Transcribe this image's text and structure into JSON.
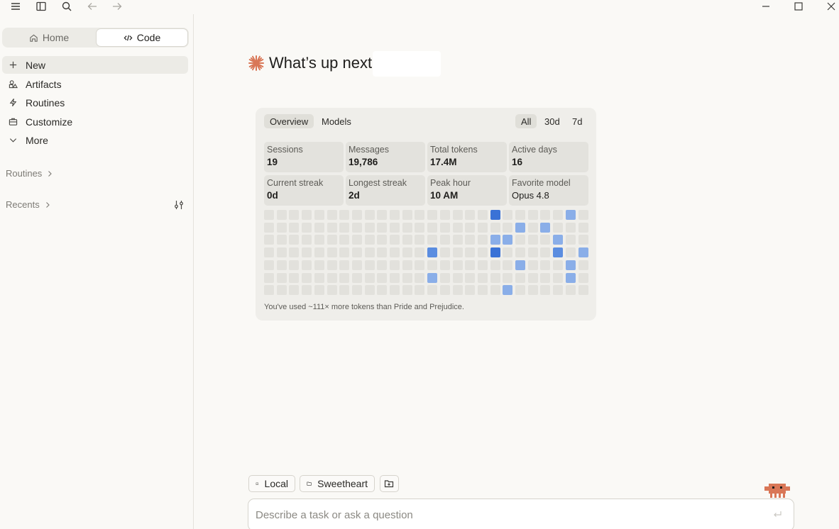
{
  "topbar": {
    "icons": [
      "menu-icon",
      "sidebar-toggle-icon",
      "search-icon",
      "back-arrow-icon",
      "forward-arrow-icon",
      "minimize-icon",
      "maximize-icon",
      "close-icon"
    ]
  },
  "sidebar": {
    "segments": [
      {
        "label": "Home",
        "icon": "home-icon",
        "active": false
      },
      {
        "label": "Code",
        "icon": "code-icon",
        "active": true
      }
    ],
    "nav": [
      {
        "label": "New",
        "icon": "plus-icon"
      },
      {
        "label": "Artifacts",
        "icon": "artifacts-icon"
      },
      {
        "label": "Routines",
        "icon": "bolt-icon"
      },
      {
        "label": "Customize",
        "icon": "briefcase-icon"
      },
      {
        "label": "More",
        "icon": "chevron-down-icon"
      }
    ],
    "sections": [
      {
        "label": "Routines"
      },
      {
        "label": "Recents"
      }
    ]
  },
  "main": {
    "greeting": "What’s up next,"
  },
  "stats": {
    "tabs": [
      "Overview",
      "Models"
    ],
    "ranges": [
      "All",
      "30d",
      "7d"
    ],
    "cards": [
      {
        "label": "Sessions",
        "value": "19"
      },
      {
        "label": "Messages",
        "value": "19,786"
      },
      {
        "label": "Total tokens",
        "value": "17.4M"
      },
      {
        "label": "Active days",
        "value": "16"
      },
      {
        "label": "Current streak",
        "value": "0d"
      },
      {
        "label": "Longest streak",
        "value": "2d"
      },
      {
        "label": "Peak hour",
        "value": "10 AM"
      },
      {
        "label": "Favorite model",
        "value": "Opus 4.8"
      }
    ],
    "heatmap": {
      "columns": 26,
      "rows": 7,
      "active_cells": [
        {
          "col": 18,
          "row": 0,
          "level": 3
        },
        {
          "col": 24,
          "row": 0,
          "level": 1
        },
        {
          "col": 20,
          "row": 1,
          "level": 1
        },
        {
          "col": 22,
          "row": 1,
          "level": 1
        },
        {
          "col": 18,
          "row": 2,
          "level": 1
        },
        {
          "col": 19,
          "row": 2,
          "level": 1
        },
        {
          "col": 23,
          "row": 2,
          "level": 1
        },
        {
          "col": 13,
          "row": 3,
          "level": 2
        },
        {
          "col": 18,
          "row": 3,
          "level": 3
        },
        {
          "col": 23,
          "row": 3,
          "level": 2
        },
        {
          "col": 25,
          "row": 3,
          "level": 1
        },
        {
          "col": 20,
          "row": 4,
          "level": 1
        },
        {
          "col": 24,
          "row": 4,
          "level": 1
        },
        {
          "col": 13,
          "row": 5,
          "level": 1
        },
        {
          "col": 24,
          "row": 5,
          "level": 1
        },
        {
          "col": 19,
          "row": 6,
          "level": 1
        }
      ]
    },
    "footer": "You've used ~111× more tokens than Pride and Prejudice."
  },
  "composer": {
    "env_label": "Local",
    "folder_label": "Sweetheart",
    "placeholder": "Describe a task or ask a question"
  },
  "colors": {
    "accent": "#d97757",
    "heat_empty": "#e2e1dc",
    "heat_1": "#8aaee8",
    "heat_2": "#5b8de0",
    "heat_3": "#3a72d6"
  }
}
